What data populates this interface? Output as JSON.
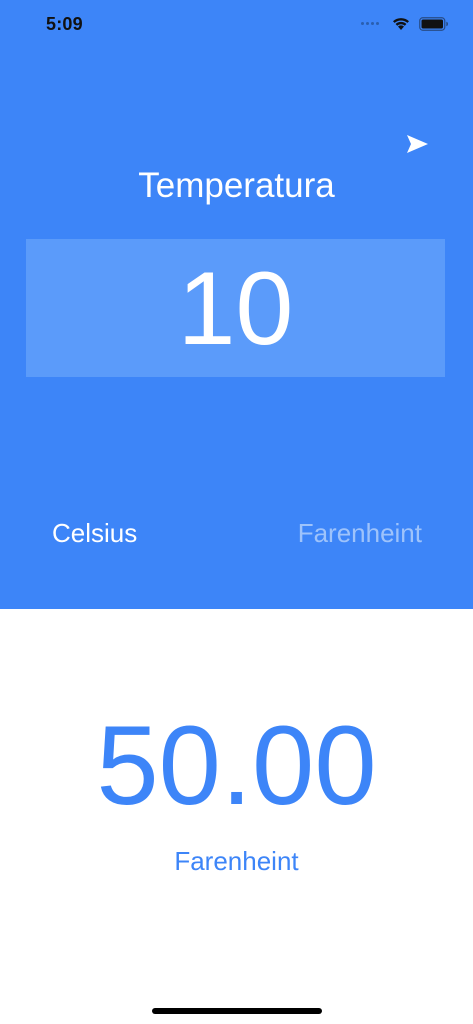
{
  "status_bar": {
    "time": "5:09"
  },
  "header": {
    "title": "Temperatura"
  },
  "input": {
    "value": "10"
  },
  "units": {
    "from_label": "Celsius",
    "to_label": "Farenheint"
  },
  "result": {
    "value": "50.00",
    "unit_label": "Farenheint"
  },
  "colors": {
    "accent": "#3d85f8",
    "input_background": "#5b9bfa",
    "inactive_unit": "#9ec3fb"
  },
  "icons": {
    "send": "send-icon",
    "wifi": "wifi-icon",
    "battery": "battery-icon",
    "signal": "signal-icon"
  }
}
